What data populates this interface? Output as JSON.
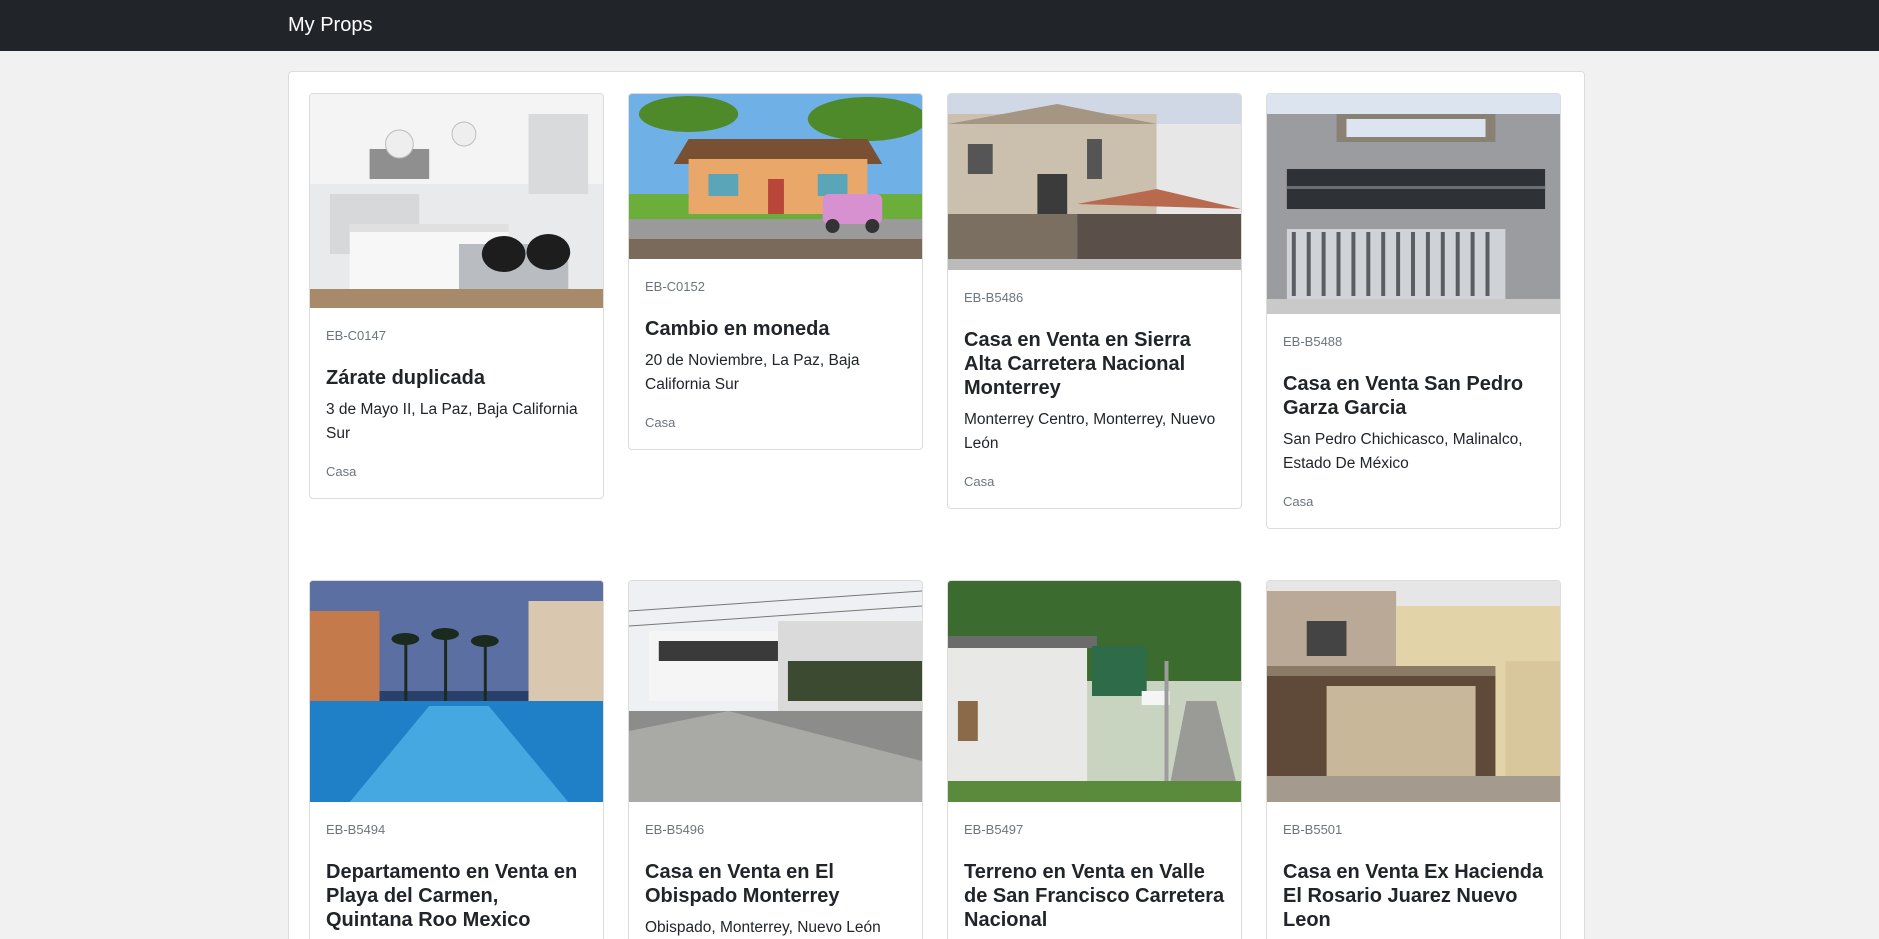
{
  "navbar": {
    "brand": "My Props"
  },
  "properties": [
    {
      "code": "EB-C0147",
      "title": "Zárate duplicada",
      "address": "3 de Mayo II, La Paz, Baja California Sur",
      "type": "Casa",
      "image": "kitchen-photo"
    },
    {
      "code": "EB-C0152",
      "title": "Cambio en moneda",
      "address": "20 de Noviembre, La Paz, Baja California Sur",
      "type": "Casa",
      "image": "cartoon-house-photo"
    },
    {
      "code": "EB-B5486",
      "title": "Casa en Venta en Sierra Alta Carretera Nacional Monterrey",
      "address": "Monterrey Centro, Monterrey, Nuevo León",
      "type": "Casa",
      "image": "two-story-house-photo"
    },
    {
      "code": "EB-B5488",
      "title": "Casa en Venta San Pedro Garza Garcia",
      "address": "San Pedro Chichicasco, Malinalco, Estado De México",
      "type": "Casa",
      "image": "modern-house-photo"
    },
    {
      "code": "EB-B5494",
      "title": "Departamento en Venta en Playa del Carmen, Quintana Roo Mexico",
      "address": "",
      "type": "",
      "image": "pool-resort-photo"
    },
    {
      "code": "EB-B5496",
      "title": "Casa en Venta en El Obispado Monterrey",
      "address": "Obispado, Monterrey, Nuevo León",
      "type": "",
      "image": "street-house-photo"
    },
    {
      "code": "EB-B5497",
      "title": "Terreno en Venta en Valle de San Francisco Carretera Nacional",
      "address": "",
      "type": "",
      "image": "land-entrance-photo"
    },
    {
      "code": "EB-B5501",
      "title": "Casa en Venta Ex Hacienda El Rosario Juarez Nuevo Leon",
      "address": "",
      "type": "",
      "image": "townhouse-photo"
    }
  ]
}
